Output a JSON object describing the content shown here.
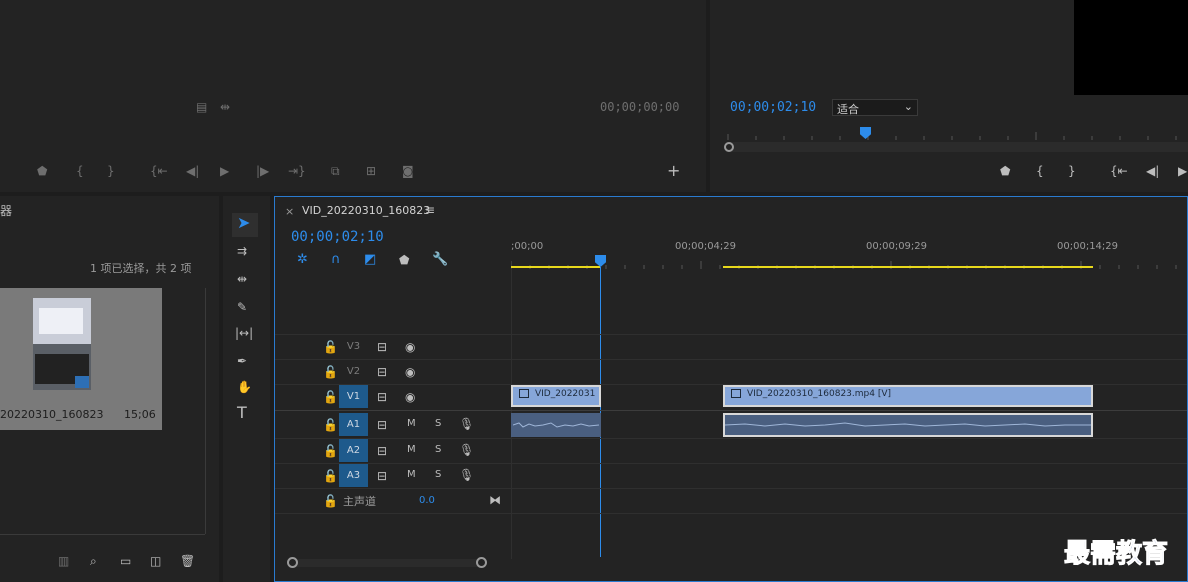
{
  "source_monitor": {
    "timecode": "00;00;00;00"
  },
  "program_monitor": {
    "timecode": "00;00;02;10",
    "zoom": "适合"
  },
  "project": {
    "title_fragment": "器",
    "selection_status": "1 项已选择，共 2 项",
    "item_name": "20220310_160823",
    "item_duration": "15;06"
  },
  "timeline": {
    "tab_close": "×",
    "tab_title": "VID_20220310_160823",
    "tab_menu": "≡",
    "timecode": "00;00;02;10",
    "ruler": [
      ";00;00",
      "00;00;04;29",
      "00;00;09;29",
      "00;00;14;29"
    ],
    "tracks_video": [
      "V3",
      "V2",
      "V1"
    ],
    "tracks_audio": [
      "A1",
      "A2",
      "A3"
    ],
    "mute_label": "M",
    "solo_label": "S",
    "master_label": "主声道",
    "master_value": "0.0",
    "clip1_label": "VID_2022031",
    "clip2_label": "VID_20220310_160823.mp4 [V]"
  },
  "watermark": "最需教育"
}
